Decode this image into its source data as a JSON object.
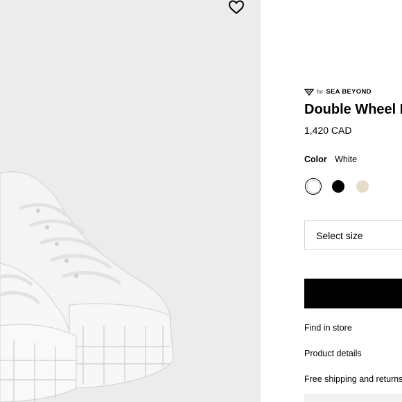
{
  "product": {
    "brand_prefix": "for",
    "brand_name": "SEA BEYOND",
    "title": "Double Wheel F",
    "price": "1,420 CAD"
  },
  "color": {
    "label": "Color",
    "selected": "White",
    "swatches": [
      {
        "name": "white",
        "hex": "#ffffff"
      },
      {
        "name": "black",
        "hex": "#000000"
      },
      {
        "name": "cream",
        "hex": "#e6dcc8"
      }
    ]
  },
  "size": {
    "placeholder": "Select size"
  },
  "links": {
    "find_in_store": "Find in store",
    "product_details": "Product details",
    "shipping": "Free shipping and returns"
  },
  "icons": [
    "heart-icon",
    "sea-beyond-logo-icon"
  ]
}
